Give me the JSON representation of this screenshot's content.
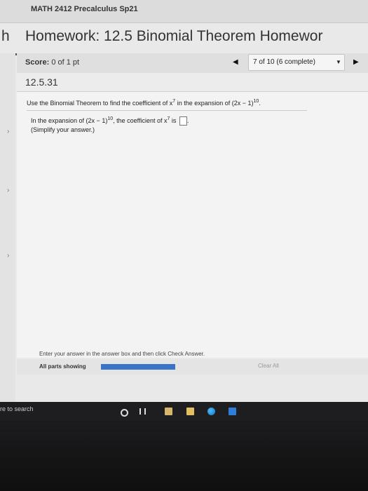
{
  "course": {
    "title": "MATH 2412 Precalculus Sp21"
  },
  "homework": {
    "left_letter": "h",
    "title": "Homework: 12.5 Binomial Theorem Homewor"
  },
  "score": {
    "label": "Score:",
    "value": "0 of 1 pt"
  },
  "navigator": {
    "prev_icon": "triangle-left",
    "status": "7 of 10 (6 complete)",
    "dropdown_icon": "triangle-down",
    "next_icon": "triangle-right"
  },
  "question": {
    "number": "12.5.31",
    "instruction_a": "Use the Binomial Theorem to find the coefficient of x",
    "instruction_exp": "7",
    "instruction_b": " in the expansion of (2x − 1)",
    "instruction_power": "10",
    "instruction_end": ".",
    "prompt_a": "In the expansion of (2x − 1)",
    "prompt_power": "10",
    "prompt_b": ", the coefficient of x",
    "prompt_exp": "7",
    "prompt_c": " is",
    "answer_value": "",
    "hint": "(Simplify your answer.)"
  },
  "footer": {
    "enter_instruction": "Enter your answer in the answer box and then click Check Answer.",
    "parts_label": "All parts showing",
    "parts_progress": 1.0,
    "clear_all": "Clear All"
  },
  "taskbar": {
    "search_text": "re to search",
    "icons": [
      "cortana-icon",
      "task-view-icon",
      "calendar-icon",
      "file-explorer-icon",
      "edge-icon",
      "mail-icon"
    ]
  },
  "colors": {
    "accent": "#3a73c8",
    "page_background": "#e9e9e9",
    "taskbar": "#1e1e20"
  }
}
